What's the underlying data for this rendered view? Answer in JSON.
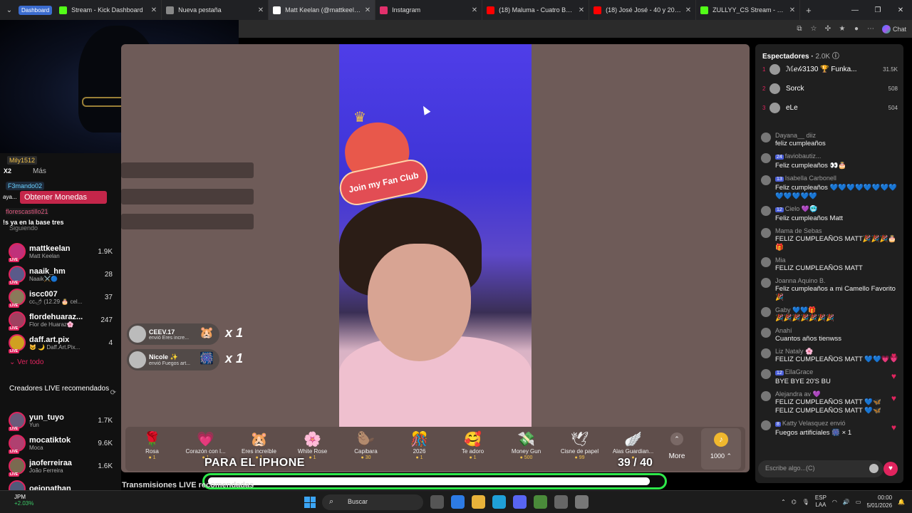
{
  "browser": {
    "tab_group": "Dashboard",
    "tabs": [
      {
        "label": "Stream - Kick Dashboard",
        "color": "#53fc18"
      },
      {
        "label": "Nueva pestaña",
        "color": "#888888"
      },
      {
        "label": "Matt Keelan (@mattkeelan)",
        "color": "#ffffff",
        "active": true
      },
      {
        "label": "Instagram",
        "color": "#e1306c"
      },
      {
        "label": "(18) Maluma - Cuatro Babys (Ly",
        "color": "#ff0000"
      },
      {
        "label": "(18) José José - 40 y 20 (Video",
        "color": "#ff0000"
      },
      {
        "label": "ZULLYY_CS Stream - Watch Live",
        "color": "#53fc18"
      }
    ],
    "chat_button": "Chat"
  },
  "overlay": {
    "mily": "Mily1512",
    "x2": "X2",
    "mas": "Más",
    "f3": "F3mando02",
    "obtener": "Obtener Monedas",
    "aya": "aya...",
    "flores": "florescastillo21",
    "base": "!s ya en la base tres",
    "siguiendo": "Siguiendo"
  },
  "following": [
    {
      "name": "mattkeelan",
      "sub": "Matt Keelan",
      "count": "1.9K",
      "color": "#c0307a"
    },
    {
      "name": "naaik_hm",
      "sub": "Naaik⚔️🔵",
      "count": "28",
      "color": "#5a5a8a"
    },
    {
      "name": "iscc007",
      "sub": "cc🌶 (12.29 🎂 cel...",
      "count": "37",
      "color": "#8a7a5a"
    },
    {
      "name": "flordehuaraz...",
      "sub": "Flor de Huaraz🌸",
      "count": "247",
      "color": "#a04060"
    },
    {
      "name": "daff.art.pix",
      "sub": "😺 🌙 Daff.Art.Pix...",
      "count": "4",
      "color": "#d0a020"
    }
  ],
  "ver_todo": "Ver todo",
  "recomendados_title": "Creadores LIVE recomendados",
  "recomendados": [
    {
      "name": "yun_tuyo",
      "sub": "Yun",
      "count": "1.7K",
      "color": "#6a5a7a"
    },
    {
      "name": "mocatiktok",
      "sub": "Moca",
      "count": "9.6K",
      "color": "#b04070"
    },
    {
      "name": "jaoferreiraa",
      "sub": "João Ferreira",
      "count": "1.6K",
      "color": "#7a6a50"
    },
    {
      "name": "oejonathan",
      "sub": "",
      "count": "",
      "color": "#505a7a"
    }
  ],
  "fan_club": "Join my Fan Club",
  "gift_msgs": [
    {
      "name": "CEEV.17",
      "sub": "envió Eres incre...",
      "icon": "🐹",
      "mult": "x 1"
    },
    {
      "name": "Nicole ✨",
      "sub": "envió Fuegos art...",
      "icon": "🎆",
      "mult": "x 1"
    }
  ],
  "gifts": [
    {
      "label": "Rosa",
      "price": "1",
      "icon": "🌹"
    },
    {
      "label": "Corazón con l...",
      "price": "1",
      "icon": "💗"
    },
    {
      "label": "Eres increíble",
      "price": "1",
      "icon": "🐹"
    },
    {
      "label": "White Rose",
      "price": "1",
      "icon": "🌸"
    },
    {
      "label": "Capibara",
      "price": "30",
      "icon": "🦫"
    },
    {
      "label": "2026",
      "price": "1",
      "icon": "🎊"
    },
    {
      "label": "Te adoro",
      "price": "1",
      "icon": "🥰"
    },
    {
      "label": "Money Gun",
      "price": "500",
      "icon": "💸"
    },
    {
      "label": "Cisne de papel",
      "price": "99",
      "icon": "🕊"
    },
    {
      "label": "Alas Guardian...",
      "price": "",
      "icon": "🪽"
    }
  ],
  "more_label": "More",
  "coins_label": "1000",
  "goal": {
    "text": "PARA EL IPHONE",
    "current": 39,
    "target": 40,
    "counter": "39 / 40"
  },
  "transmisiones": "Transmisiones LIVE recomendadas",
  "viewers": {
    "title": "Espectadores",
    "count": "2.0K",
    "top": [
      {
        "rank": "1",
        "name": "ℳℯ𝓁𝒾3130 🏆 Funka...",
        "count": "31.5K"
      },
      {
        "rank": "2",
        "name": "Sorck",
        "count": "508"
      },
      {
        "rank": "3",
        "name": "eLe",
        "count": "504"
      }
    ]
  },
  "chat": [
    {
      "user": "Dayana__ diiz",
      "text": "feliz cumpleaños",
      "heart": false
    },
    {
      "user": "faviobautiz...",
      "badge": "24",
      "text": "Feliz cumpleaños 👀🎂",
      "heart": false
    },
    {
      "user": "Isabella Carbonell",
      "badge": "13",
      "text": "Feliz cumpleaños 💙💙💙💙💙💙💙💙💙💙💙💙💙",
      "heart": false
    },
    {
      "user": "Cielo 💜🥶",
      "badge": "12",
      "text": "Feliz cumpleaños Matt",
      "heart": false
    },
    {
      "user": "Mama de Sebas",
      "text": "FELIZ CUMPLEAÑOS MATT🎉🎉🎉🎂🎁",
      "heart": false
    },
    {
      "user": "Mia",
      "text": "FELIZ CUMPLEAÑOS MATT",
      "heart": false
    },
    {
      "user": "Joanna Aquino B.",
      "text": "Feliz cumpleaños a mi Camello Favorito 🎉",
      "heart": false
    },
    {
      "user": "Gaby 💙💙🎁",
      "text": "🎉🎉🎉🎉🎉🎉🎉",
      "heart": false
    },
    {
      "user": "Anahí",
      "text": "Cuantos años tienwss",
      "heart": false
    },
    {
      "user": "Liz Nataly 🌸",
      "text": "FELIZ CUMPLEAÑOS MATT 💙💙💗💗",
      "heart": true
    },
    {
      "user": "EllaGrace",
      "badge": "12",
      "text": "BYE BYE 20'S BU",
      "heart": true
    },
    {
      "user": "Alejandra av 💜",
      "text": "FELIZ CUMPLEAÑOS MATT 💙🦋 FELIZ CUMPLEAÑOS MATT 💙🦋",
      "heart": true
    },
    {
      "user": "Katty Velasquez envió",
      "badge": "8",
      "text": "Fuegos artificiales 🎆 × 1",
      "heart": true
    }
  ],
  "input_placeholder": "Escribe algo...(C)",
  "taskbar": {
    "stock": "JPM",
    "stock_change": "+2.03%",
    "search": "Buscar",
    "lang": "ESP",
    "lang2": "LAA",
    "time": "00:00",
    "date": "5/01/2026"
  }
}
